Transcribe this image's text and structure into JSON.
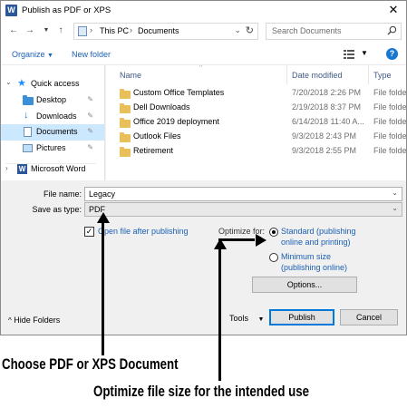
{
  "window": {
    "title": "Publish as PDF or XPS",
    "app_icon_letter": "W",
    "close_glyph": "✕"
  },
  "address": {
    "segments": [
      "This PC",
      "Documents"
    ],
    "search_placeholder": "Search Documents"
  },
  "toolbar": {
    "organize_label": "Organize",
    "new_folder_label": "New folder"
  },
  "nav": {
    "items": [
      {
        "label": "Quick access"
      },
      {
        "label": "Desktop"
      },
      {
        "label": "Downloads"
      },
      {
        "label": "Documents",
        "selected": true
      },
      {
        "label": "Pictures"
      },
      {
        "label": "Microsoft Word"
      }
    ]
  },
  "file_list": {
    "columns": [
      "Name",
      "Date modified",
      "Type"
    ],
    "rows": [
      {
        "name": "Custom Office Templates",
        "date": "7/20/2018 2:26 PM",
        "type": "File folder"
      },
      {
        "name": "Dell Downloads",
        "date": "2/19/2018 8:37 PM",
        "type": "File folder"
      },
      {
        "name": "Office 2019 deployment",
        "date": "6/14/2018 11:40 A...",
        "type": "File folder"
      },
      {
        "name": "Outlook Files",
        "date": "9/3/2018 2:43 PM",
        "type": "File folder"
      },
      {
        "name": "Retirement",
        "date": "9/3/2018 2:55 PM",
        "type": "File folder"
      }
    ]
  },
  "fields": {
    "file_name_label": "File name:",
    "file_name_value": "Legacy",
    "save_type_label": "Save as type:",
    "save_type_value": "PDF"
  },
  "options": {
    "open_after_label": "Open file after publishing",
    "open_after_checked": true,
    "optimize_label": "Optimize for:",
    "standard_label_1": "Standard (publishing",
    "standard_label_2": "online and printing)",
    "minimum_label_1": "Minimum size",
    "minimum_label_2": "(publishing online)",
    "options_button": "Options..."
  },
  "footer": {
    "hide_folders_label": "Hide Folders",
    "tools_label": "Tools",
    "publish_button": "Publish",
    "cancel_button": "Cancel"
  },
  "annotations": {
    "callout_1": "Choose PDF or XPS Document",
    "callout_2": "Optimize file size for the intended use"
  },
  "colors": {
    "link_blue": "#1a5fb4",
    "selection": "#cce8ff",
    "folder_yellow": "#e8c05a",
    "word_blue": "#2b579a"
  }
}
